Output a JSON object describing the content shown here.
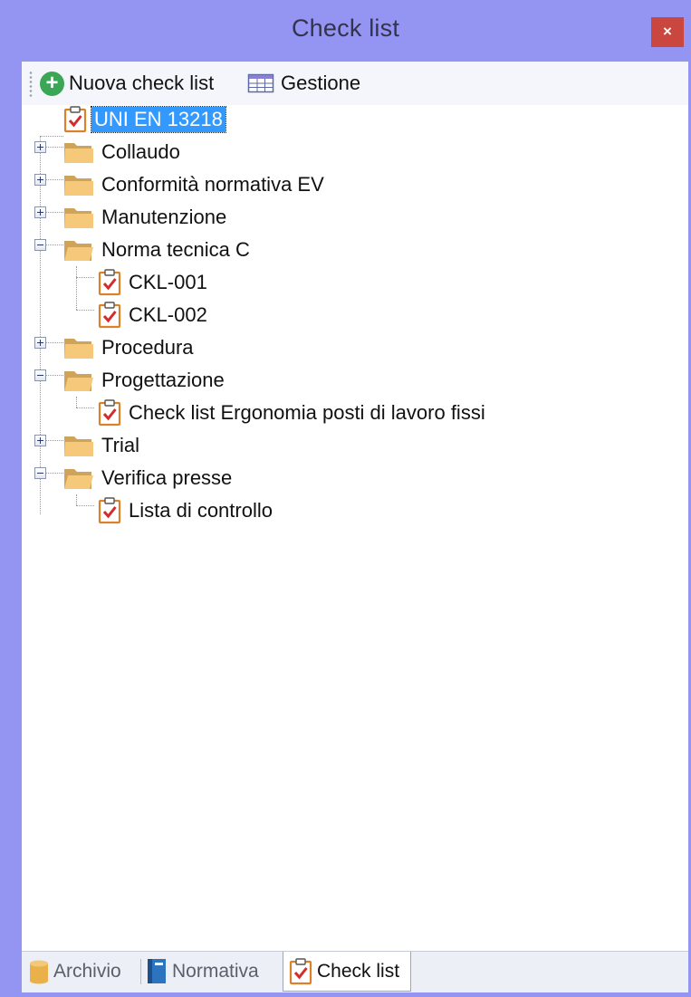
{
  "window": {
    "title": "Check list",
    "close_label": "×"
  },
  "toolbar": {
    "new_label": "Nuova check list",
    "manage_label": "Gestione"
  },
  "tree": {
    "root": {
      "label": "UNI EN 13218",
      "selected": true
    },
    "folders": [
      {
        "label": "Collaudo",
        "expanded": false,
        "children": []
      },
      {
        "label": "Conformità normativa EV",
        "expanded": false,
        "children": []
      },
      {
        "label": "Manutenzione",
        "expanded": false,
        "children": []
      },
      {
        "label": "Norma tecnica C",
        "expanded": true,
        "children": [
          "CKL-001",
          "CKL-002"
        ]
      },
      {
        "label": "Procedura",
        "expanded": false,
        "children": []
      },
      {
        "label": "Progettazione",
        "expanded": true,
        "children": [
          "Check list Ergonomia posti di lavoro fissi"
        ]
      },
      {
        "label": "Trial",
        "expanded": false,
        "children": []
      },
      {
        "label": "Verifica presse",
        "expanded": true,
        "children": [
          "Lista di controllo"
        ]
      }
    ]
  },
  "tabs": [
    {
      "label": "Archivio",
      "icon": "database-icon",
      "active": false
    },
    {
      "label": "Normativa",
      "icon": "book-icon",
      "active": false
    },
    {
      "label": "Check list",
      "icon": "clipboard-check-icon",
      "active": true
    }
  ],
  "colors": {
    "frame": "#9494f2",
    "close": "#c9473f",
    "selection": "#3399ff",
    "add": "#3aa656"
  }
}
